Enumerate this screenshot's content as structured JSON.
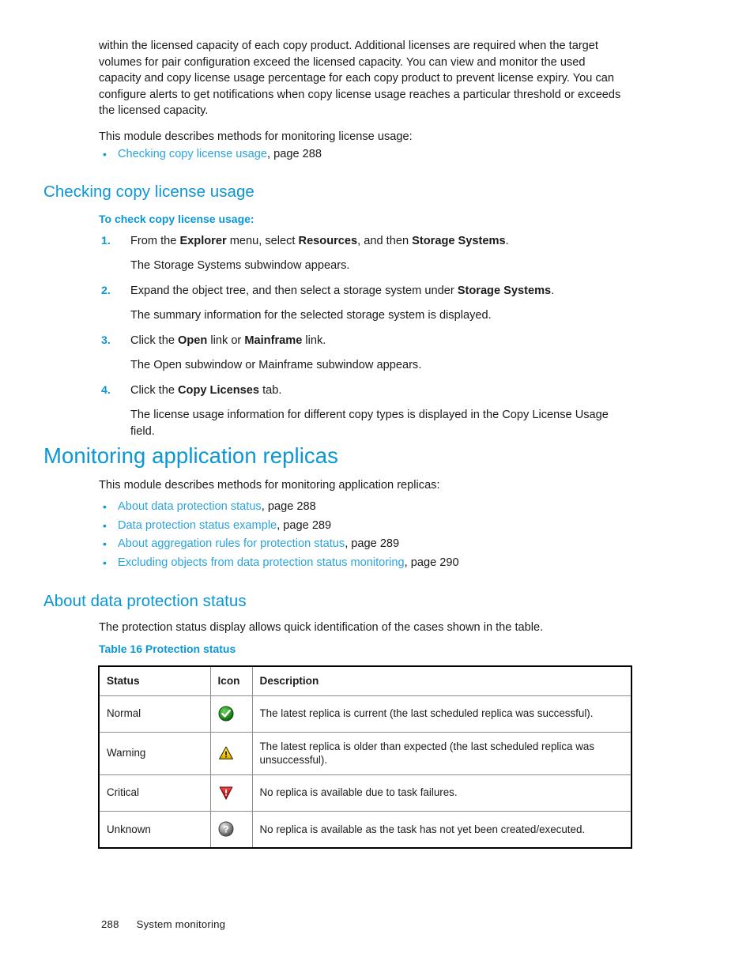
{
  "intro": {
    "paragraph1": "within the licensed capacity of each copy product. Additional licenses are required when the target volumes for pair configuration exceed the licensed capacity. You can view and monitor the used capacity and copy license usage percentage for each copy product to prevent license expiry. You can configure alerts to get notifications when copy license usage reaches a particular threshold or exceeds the licensed capacity.",
    "paragraph2": "This module describes methods for monitoring license usage:",
    "links": [
      {
        "text": "Checking copy license usage",
        "suffix": ", page 288"
      }
    ]
  },
  "section_checking": {
    "heading": "Checking copy license usage",
    "procedure_title": "To check copy license usage:",
    "steps": [
      {
        "number": "1.",
        "parts": [
          {
            "text": "From the ",
            "bold": false
          },
          {
            "text": "Explorer",
            "bold": true
          },
          {
            "text": " menu, select ",
            "bold": false
          },
          {
            "text": "Resources",
            "bold": true
          },
          {
            "text": ", and then ",
            "bold": false
          },
          {
            "text": "Storage Systems",
            "bold": true
          },
          {
            "text": ".",
            "bold": false
          }
        ],
        "result": "The Storage Systems subwindow appears."
      },
      {
        "number": "2.",
        "parts": [
          {
            "text": "Expand the object tree, and then select a storage system under ",
            "bold": false
          },
          {
            "text": "Storage Systems",
            "bold": true
          },
          {
            "text": ".",
            "bold": false
          }
        ],
        "result": "The summary information for the selected storage system is displayed."
      },
      {
        "number": "3.",
        "parts": [
          {
            "text": "Click the ",
            "bold": false
          },
          {
            "text": "Open",
            "bold": true
          },
          {
            "text": " link or ",
            "bold": false
          },
          {
            "text": "Mainframe",
            "bold": true
          },
          {
            "text": " link.",
            "bold": false
          }
        ],
        "result": "The Open subwindow or Mainframe subwindow appears."
      },
      {
        "number": "4.",
        "parts": [
          {
            "text": "Click the ",
            "bold": false
          },
          {
            "text": "Copy Licenses",
            "bold": true
          },
          {
            "text": " tab.",
            "bold": false
          }
        ],
        "result": "The license usage information for different copy types is displayed in the Copy License Usage field."
      }
    ]
  },
  "section_monitoring": {
    "heading": "Monitoring application replicas",
    "paragraph": "This module describes methods for monitoring application replicas:",
    "links": [
      {
        "text": "About data protection status",
        "suffix": ", page 288"
      },
      {
        "text": "Data protection status example",
        "suffix": ", page 289"
      },
      {
        "text": "About aggregation rules for protection status",
        "suffix": ", page 289"
      },
      {
        "text": "Excluding objects from data protection status monitoring",
        "suffix": ", page 290"
      }
    ]
  },
  "section_about": {
    "heading": "About data protection status",
    "paragraph": "The protection status display allows quick identification of the cases shown in the table.",
    "table_caption": "Table 16 Protection status",
    "table": {
      "headers": [
        "Status",
        "Icon",
        "Description"
      ],
      "rows": [
        {
          "status": "Normal",
          "icon": "green-check-circle-icon",
          "description": "The latest replica is current (the last scheduled replica was successful)."
        },
        {
          "status": "Warning",
          "icon": "yellow-warning-triangle-icon",
          "description": "The latest replica is older than expected (the last scheduled replica was unsuccessful)."
        },
        {
          "status": "Critical",
          "icon": "red-critical-triangle-icon",
          "description": "No replica is available due to task failures."
        },
        {
          "status": "Unknown",
          "icon": "gray-question-sphere-icon",
          "description": "No replica is available as the task has not yet been created/executed."
        }
      ]
    }
  },
  "footer": {
    "page_number": "288",
    "section_name": "System monitoring"
  },
  "colors": {
    "heading_blue": "#0b96d5",
    "link_blue": "#2aa3dd",
    "text_black": "#1a1a1a",
    "normal_green": "#2f9e28",
    "warning_yellow": "#f5d417",
    "critical_red": "#d3191d",
    "unknown_gray": "#9a9a9a"
  }
}
